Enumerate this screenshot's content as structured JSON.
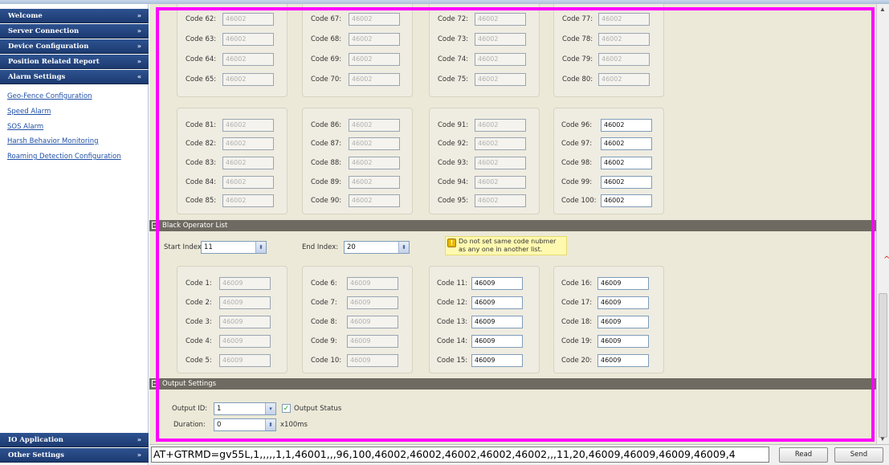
{
  "sidebar": {
    "sections": [
      {
        "label": "Welcome",
        "chevron": "»"
      },
      {
        "label": "Server Connection",
        "chevron": "»"
      },
      {
        "label": "Device Configuration",
        "chevron": "»"
      },
      {
        "label": "Position Related Report",
        "chevron": "»"
      },
      {
        "label": "Alarm Settings",
        "chevron": "«"
      }
    ],
    "alarm_links": [
      "Geo-Fence Configuration",
      "Speed Alarm",
      "SOS Alarm",
      "Harsh Behavior Monitoring",
      "Roaming Detection Configuration"
    ],
    "bottom_sections": [
      {
        "label": "IO Application",
        "chevron": "»"
      },
      {
        "label": "Other Settings",
        "chevron": "»"
      }
    ]
  },
  "white_list_top": {
    "groups": [
      {
        "codes": [
          {
            "label": "Code 62:",
            "value": "46002",
            "enabled": false
          },
          {
            "label": "Code 63:",
            "value": "46002",
            "enabled": false
          },
          {
            "label": "Code 64:",
            "value": "46002",
            "enabled": false
          },
          {
            "label": "Code 65:",
            "value": "46002",
            "enabled": false
          }
        ]
      },
      {
        "codes": [
          {
            "label": "Code 67:",
            "value": "46002",
            "enabled": false
          },
          {
            "label": "Code 68:",
            "value": "46002",
            "enabled": false
          },
          {
            "label": "Code 69:",
            "value": "46002",
            "enabled": false
          },
          {
            "label": "Code 70:",
            "value": "46002",
            "enabled": false
          }
        ]
      },
      {
        "codes": [
          {
            "label": "Code 72:",
            "value": "46002",
            "enabled": false
          },
          {
            "label": "Code 73:",
            "value": "46002",
            "enabled": false
          },
          {
            "label": "Code 74:",
            "value": "46002",
            "enabled": false
          },
          {
            "label": "Code 75:",
            "value": "46002",
            "enabled": false
          }
        ]
      },
      {
        "codes": [
          {
            "label": "Code 77:",
            "value": "46002",
            "enabled": false
          },
          {
            "label": "Code 78:",
            "value": "46002",
            "enabled": false
          },
          {
            "label": "Code 79:",
            "value": "46002",
            "enabled": false
          },
          {
            "label": "Code 80:",
            "value": "46002",
            "enabled": false
          }
        ]
      }
    ]
  },
  "white_list_bottom": {
    "groups": [
      {
        "codes": [
          {
            "label": "Code 81:",
            "value": "46002",
            "enabled": false
          },
          {
            "label": "Code 82:",
            "value": "46002",
            "enabled": false
          },
          {
            "label": "Code 83:",
            "value": "46002",
            "enabled": false
          },
          {
            "label": "Code 84:",
            "value": "46002",
            "enabled": false
          },
          {
            "label": "Code 85:",
            "value": "46002",
            "enabled": false
          }
        ]
      },
      {
        "codes": [
          {
            "label": "Code 86:",
            "value": "46002",
            "enabled": false
          },
          {
            "label": "Code 87:",
            "value": "46002",
            "enabled": false
          },
          {
            "label": "Code 88:",
            "value": "46002",
            "enabled": false
          },
          {
            "label": "Code 89:",
            "value": "46002",
            "enabled": false
          },
          {
            "label": "Code 90:",
            "value": "46002",
            "enabled": false
          }
        ]
      },
      {
        "codes": [
          {
            "label": "Code 91:",
            "value": "46002",
            "enabled": false
          },
          {
            "label": "Code 92:",
            "value": "46002",
            "enabled": false
          },
          {
            "label": "Code 93:",
            "value": "46002",
            "enabled": false
          },
          {
            "label": "Code 94:",
            "value": "46002",
            "enabled": false
          },
          {
            "label": "Code 95:",
            "value": "46002",
            "enabled": false
          }
        ]
      },
      {
        "codes": [
          {
            "label": "Code 96:",
            "value": "46002",
            "enabled": true
          },
          {
            "label": "Code 97:",
            "value": "46002",
            "enabled": true
          },
          {
            "label": "Code 98:",
            "value": "46002",
            "enabled": true
          },
          {
            "label": "Code 99:",
            "value": "46002",
            "enabled": true
          },
          {
            "label": "Code 100:",
            "value": "46002",
            "enabled": true
          }
        ]
      }
    ]
  },
  "black_list": {
    "title": "Black Operator List",
    "start_index_label": "Start Index:",
    "start_index_value": "11",
    "end_index_label": "End Index:",
    "end_index_value": "20",
    "tip": "Do not set same code nubmer as any one in another list.",
    "groups": [
      {
        "codes": [
          {
            "label": "Code 1:",
            "value": "46009",
            "enabled": false
          },
          {
            "label": "Code 2:",
            "value": "46009",
            "enabled": false
          },
          {
            "label": "Code 3:",
            "value": "46009",
            "enabled": false
          },
          {
            "label": "Code 4:",
            "value": "46009",
            "enabled": false
          },
          {
            "label": "Code 5:",
            "value": "46009",
            "enabled": false
          }
        ]
      },
      {
        "codes": [
          {
            "label": "Code 6:",
            "value": "46009",
            "enabled": false
          },
          {
            "label": "Code 7:",
            "value": "46009",
            "enabled": false
          },
          {
            "label": "Code 8:",
            "value": "46009",
            "enabled": false
          },
          {
            "label": "Code 9:",
            "value": "46009",
            "enabled": false
          },
          {
            "label": "Code 10:",
            "value": "46009",
            "enabled": false
          }
        ]
      },
      {
        "codes": [
          {
            "label": "Code 11:",
            "value": "46009",
            "enabled": true
          },
          {
            "label": "Code 12:",
            "value": "46009",
            "enabled": true
          },
          {
            "label": "Code 13:",
            "value": "46009",
            "enabled": true
          },
          {
            "label": "Code 14:",
            "value": "46009",
            "enabled": true
          },
          {
            "label": "Code 15:",
            "value": "46009",
            "enabled": true
          }
        ]
      },
      {
        "codes": [
          {
            "label": "Code 16:",
            "value": "46009",
            "enabled": true
          },
          {
            "label": "Code 17:",
            "value": "46009",
            "enabled": true
          },
          {
            "label": "Code 18:",
            "value": "46009",
            "enabled": true
          },
          {
            "label": "Code 19:",
            "value": "46009",
            "enabled": true
          },
          {
            "label": "Code 20:",
            "value": "46009",
            "enabled": true
          }
        ]
      }
    ]
  },
  "output_settings": {
    "title": "Output Settings",
    "output_id_label": "Output ID:",
    "output_id_value": "1",
    "output_status_label": "Output Status",
    "output_status_checked": true,
    "duration_label": "Duration:",
    "duration_value": "0",
    "duration_unit": "x100ms"
  },
  "command_bar": {
    "command": "AT+GTRMD=gv55L,1,,,,,1,1,46001,,,96,100,46002,46002,46002,46002,46002,,,11,20,46009,46009,46009,46009,4",
    "read_label": "Read",
    "send_label": "Send"
  },
  "colors": {
    "accent_border": "#ff00ff",
    "sidebar_header": "#1c3a70",
    "link": "#1f4fa6",
    "section_bar": "#6e6a61"
  }
}
